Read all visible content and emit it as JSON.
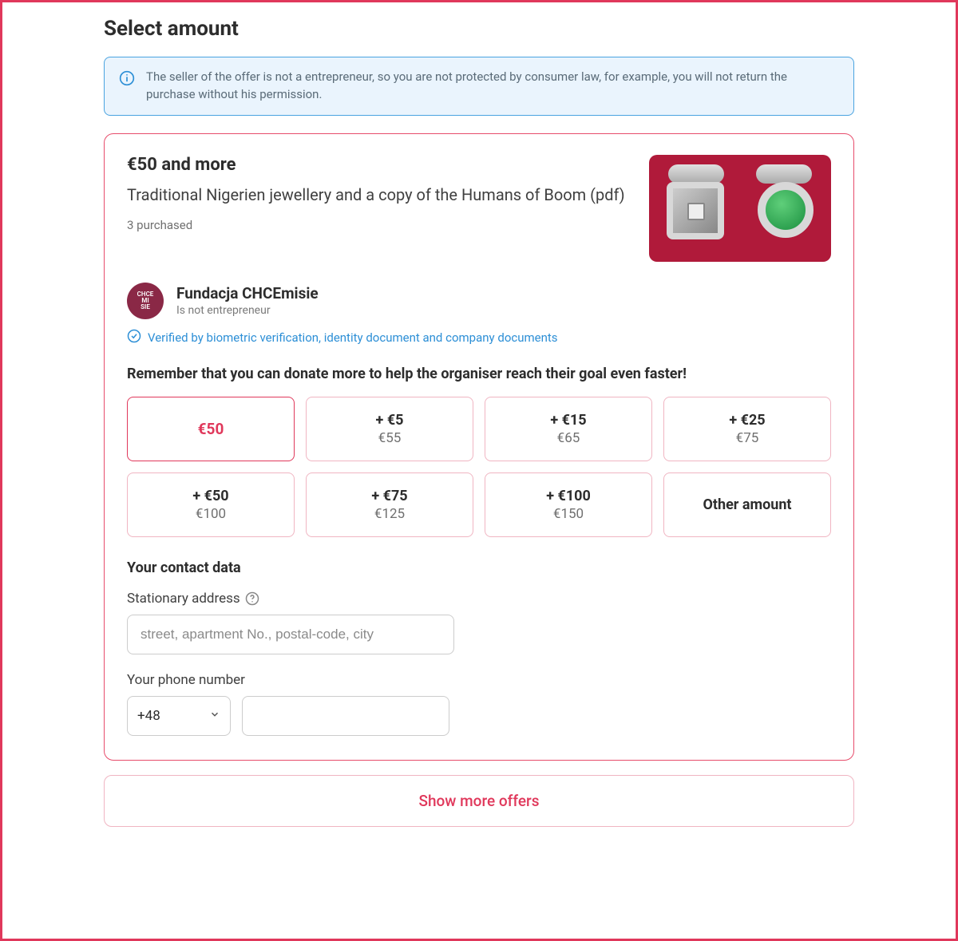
{
  "page_title": "Select amount",
  "info_banner": "The seller of the offer is not a entrepreneur, so you are not protected by consumer law, for example, you will not return the purchase without his permission.",
  "offer": {
    "tier": "€50 and more",
    "description": "Traditional Nigerien jewellery and a copy of the Humans of Boom (pdf)",
    "purchased": "3 purchased"
  },
  "seller": {
    "avatar_text_top": "CHCE",
    "avatar_text_mid": "MI",
    "avatar_text_bot": "SIE",
    "name": "Fundacja CHCEmisie",
    "status": "Is not entrepreneur",
    "verified": "Verified by biometric verification, identity document and company documents"
  },
  "donate_note": "Remember that you can donate more to help the organiser reach their goal even faster!",
  "amounts": [
    {
      "selected": true,
      "main": "€50"
    },
    {
      "plus": "+ €5",
      "total": "€55"
    },
    {
      "plus": "+ €15",
      "total": "€65"
    },
    {
      "plus": "+ €25",
      "total": "€75"
    },
    {
      "plus": "+ €50",
      "total": "€100"
    },
    {
      "plus": "+ €75",
      "total": "€125"
    },
    {
      "plus": "+ €100",
      "total": "€150"
    },
    {
      "other": true,
      "label": "Other amount"
    }
  ],
  "contact": {
    "section_label": "Your contact data",
    "address_label": "Stationary address",
    "address_placeholder": "street, apartment No., postal-code, city",
    "phone_label": "Your phone number",
    "country_code": "+48"
  },
  "show_more": "Show more offers"
}
